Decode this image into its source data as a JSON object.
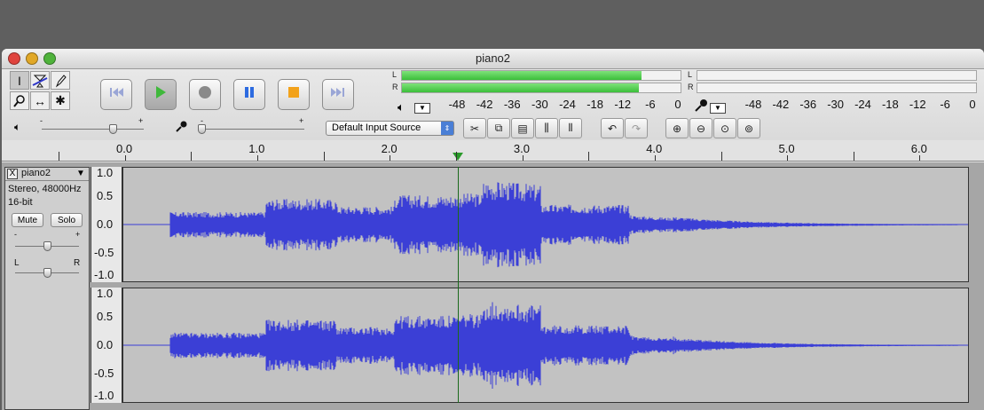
{
  "window": {
    "title": "piano2"
  },
  "meters": {
    "playback": {
      "left_label": "L",
      "right_label": "R",
      "level_left": 0.86,
      "level_right": 0.85
    },
    "record": {
      "left_label": "L",
      "right_label": "R",
      "level_left": 0,
      "level_right": 0
    },
    "scale": [
      "-48",
      "-42",
      "-36",
      "-30",
      "-24",
      "-18",
      "-12",
      "-6",
      "0"
    ]
  },
  "mixer": {
    "input_source": "Default Input Source",
    "output_slider_minus": "-",
    "output_slider_plus": "+",
    "input_slider_minus": "-",
    "input_slider_plus": "+"
  },
  "ruler": {
    "labels": [
      "0.0",
      "1.0",
      "2.0",
      "3.0",
      "4.0",
      "5.0",
      "6.0"
    ]
  },
  "track": {
    "close": "X",
    "name": "piano2",
    "format": "Stereo, 48000Hz",
    "bitdepth": "16-bit",
    "mute": "Mute",
    "solo": "Solo",
    "gain_minus": "-",
    "gain_plus": "+",
    "pan_left": "L",
    "pan_right": "R"
  },
  "amplitude_labels": [
    "1.0",
    "0.5",
    "0.0",
    "-0.5",
    "-1.0"
  ],
  "colors": {
    "waveform": "#3b3fd6",
    "meter_green": "#4cc94a",
    "cursor": "#1a6a1a"
  },
  "icons": {
    "tools": [
      "selection-tool-icon",
      "envelope-tool-icon",
      "draw-tool-icon",
      "zoom-tool-icon",
      "timeshift-tool-icon",
      "multi-tool-icon"
    ],
    "transport": [
      "skip-start-icon",
      "play-icon",
      "record-icon",
      "pause-icon",
      "stop-icon",
      "skip-end-icon"
    ]
  }
}
